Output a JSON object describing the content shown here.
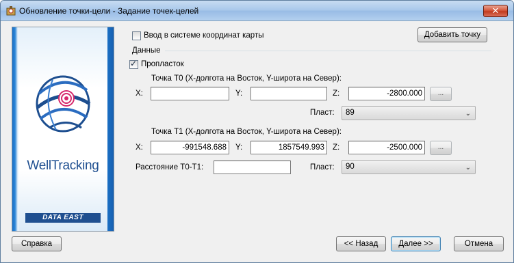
{
  "window": {
    "title": "Обновление точки-цели - Задание точек-целей",
    "close_label": "✕"
  },
  "banner": {
    "product": "WellTracking",
    "vendor": "DATA EAST"
  },
  "map_coords_checkbox": {
    "label": "Ввод в системе координат карты",
    "checked": false
  },
  "add_point_button": "Добавить точку",
  "group_label": "Данные",
  "proplastok_checkbox": {
    "label": "Пропласток",
    "checked": true
  },
  "t0": {
    "caption": "Точка Т0  (X-долгота на Восток, Y-широта на Север):",
    "x_label": "X:",
    "x_value": "",
    "y_label": "Y:",
    "y_value": "",
    "z_label": "Z:",
    "z_value": "-2800.000",
    "picker_label": "...",
    "layer_label": "Пласт:",
    "layer_value": "89"
  },
  "t1": {
    "caption": "Точка Т1  (X-долгота на Восток, Y-широта на Север):",
    "x_label": "X:",
    "x_value": "-991548.688",
    "y_label": "Y:",
    "y_value": "1857549.993",
    "z_label": "Z:",
    "z_value": "-2500.000",
    "picker_label": "...",
    "layer_label": "Пласт:",
    "layer_value": "90"
  },
  "distance": {
    "label": "Расстояние Т0-Т1:",
    "value": ""
  },
  "footer": {
    "help": "Справка",
    "back": "<< Назад",
    "next": "Далее >>",
    "cancel": "Отмена"
  },
  "colors": {
    "title_bar": "#a8c7ea",
    "close_button": "#c23b1f",
    "brand_blue": "#1f4f90"
  }
}
